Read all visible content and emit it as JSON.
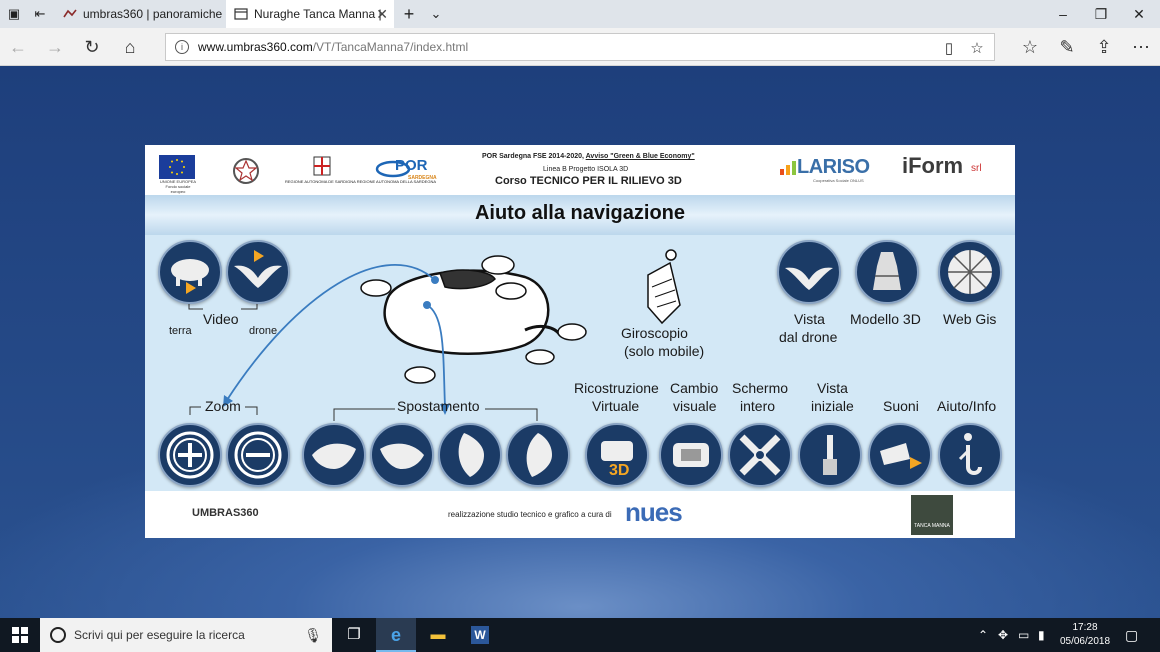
{
  "browser": {
    "tabs": [
      {
        "label": "umbras360 | panoramiche s",
        "active": false
      },
      {
        "label": "Nuraghe Tanca Manna |",
        "active": true
      }
    ],
    "url_domain": "www.umbras360.com",
    "url_path": "/VT/TancaManna7/index.html"
  },
  "header": {
    "eu_caption": "UNIONE EUROPEA Fondo sociale europeo",
    "sardegna_caption": "REGIONE AUTONOMA DE SARDIGNA REGIONE AUTONOMA DELLA SARDEGNA",
    "por_logo": "POR",
    "por_sub": "SARDEGNA",
    "program_line1": "POR Sardegna FSE 2014-2020,",
    "program_line1b": "Avviso \"Green & Blue Economy\"",
    "program_line2": "Linea B Progetto ISOLA 3D",
    "program_line3": "Corso TECNICO PER IL RILIEVO 3D",
    "lariso": "LARISO",
    "lariso_sub": "Cooperativa Sociale ONLUS",
    "iform": "iForm",
    "iform_suffix": "srl"
  },
  "title": "Aiuto alla navigazione",
  "labels": {
    "video": "Video",
    "terra": "terra",
    "drone": "drone",
    "giroscopio_1": "Giroscopio",
    "giroscopio_2": "(solo mobile)",
    "vista_drone_1": "Vista",
    "vista_drone_2": "dal drone",
    "modello_3d": "Modello 3D",
    "web_gis": "Web Gis",
    "zoom": "Zoom",
    "spostamento": "Spostamento",
    "ricostruzione_1": "Ricostruzione",
    "ricostruzione_2": "Virtuale",
    "cambio_1": "Cambio",
    "cambio_2": "visuale",
    "schermo_1": "Schermo",
    "schermo_2": "intero",
    "vista_iniziale_1": "Vista",
    "vista_iniziale_2": "iniziale",
    "suoni": "Suoni",
    "aiuto_info": "Aiuto/Info"
  },
  "footer": {
    "umbras": "UMBRAS360",
    "credit": "realizzazione studio tecnico e grafico a cura di",
    "nues": "nues",
    "tanca": "TANCA MANNA"
  },
  "taskbar": {
    "search_placeholder": "Scrivi qui per eseguire la ricerca",
    "time": "17:28",
    "date": "05/06/2018"
  },
  "colors": {
    "page_bg": "#1d3f7a",
    "card_bg": "#d3e8f6",
    "icon_circle": "#1b3b66",
    "arrow_blue": "#3a7cc0",
    "play_orange": "#f5a623"
  }
}
